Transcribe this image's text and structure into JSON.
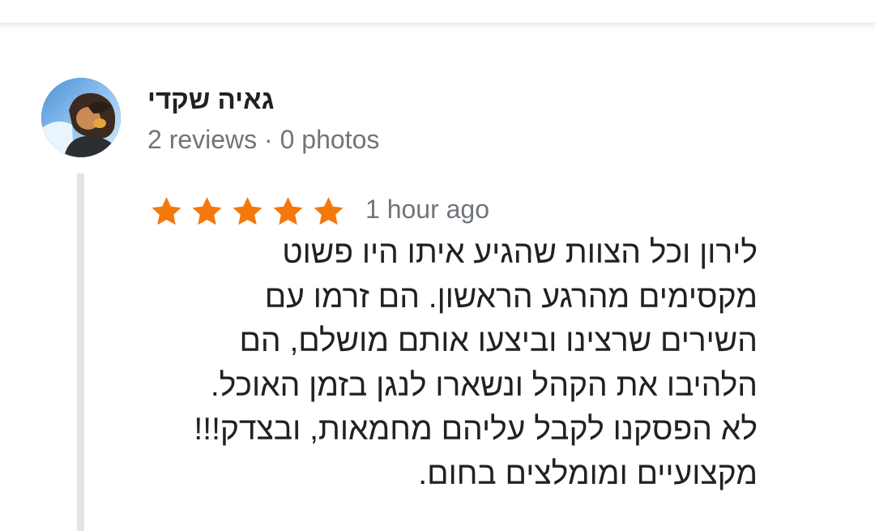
{
  "header": {
    "bar": ""
  },
  "reviewer": {
    "name": "גאיה שקדי",
    "meta": "2 reviews · 0 photos",
    "avatar_icon": "profile-photo"
  },
  "review": {
    "rating": 5,
    "rating_max": 5,
    "star_color": "#f4780c",
    "time_ago": "1 hour ago",
    "text_lines": [
      "לירון וכל הצוות שהגיע איתו היו פשוט",
      "מקסימים מהרגע הראשון. הם זרמו עם",
      "השירים שרצינו וביצעו אותם מושלם, הם",
      "הלהיבו את הקהל ונשארו לנגן בזמן האוכל.",
      "לא הפסקנו לקבל עליהם מחמאות, ובצדק!!!",
      "מקצועיים ומומלצים בחום."
    ]
  }
}
